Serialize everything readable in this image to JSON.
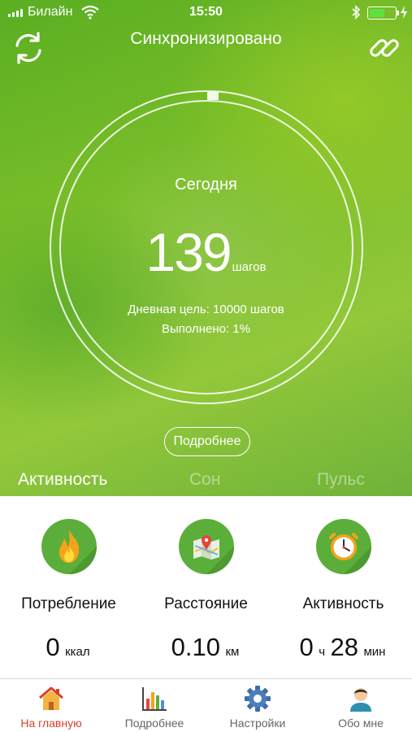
{
  "status_bar": {
    "carrier": "Билайн",
    "time": "15:50",
    "battery_level_percent": 60,
    "battery_color": "#5ee043"
  },
  "header": {
    "title": "Синхронизировано",
    "left_icon": "sync-icon",
    "right_icon": "link-icon"
  },
  "summary": {
    "period": "Сегодня",
    "steps": "139",
    "steps_unit": "шагов",
    "goal_text": "Дневная цель: 10000 шагов",
    "completion_text": "Выполнено: 1%",
    "progress_percent": 1,
    "details_button": "Подробнее"
  },
  "tabs": [
    {
      "label": "Активность",
      "active": true
    },
    {
      "label": "Сон",
      "active": false
    },
    {
      "label": "Пульс",
      "active": false
    }
  ],
  "stats": [
    {
      "icon": "flame-icon",
      "label": "Потребление",
      "value": "0",
      "unit": "ккал"
    },
    {
      "icon": "map-pin-icon",
      "label": "Расстояние",
      "value": "0.10",
      "unit": "км"
    },
    {
      "icon": "clock-icon",
      "label": "Активность",
      "hours": "0",
      "hours_unit": "ч",
      "minutes": "28",
      "minutes_unit": "мин"
    }
  ],
  "bottom_nav": [
    {
      "icon": "home-icon",
      "label": "На главную",
      "active": true
    },
    {
      "icon": "bar-chart-icon",
      "label": "Подробнее",
      "active": false
    },
    {
      "icon": "gear-icon",
      "label": "Настройки",
      "active": false
    },
    {
      "icon": "profile-icon",
      "label": "Обо мне",
      "active": false
    }
  ],
  "colors": {
    "hero_green": "#7cbf2a",
    "icon_circle_green": "#5cae3a",
    "active_nav": "#d9402b"
  }
}
